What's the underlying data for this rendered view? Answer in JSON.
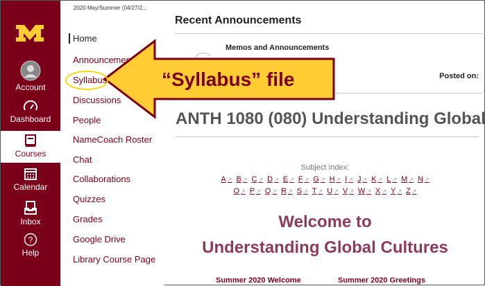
{
  "global_nav": {
    "items": [
      {
        "label": "Account",
        "icon": "account-icon"
      },
      {
        "label": "Dashboard",
        "icon": "dashboard-icon"
      },
      {
        "label": "Courses",
        "icon": "courses-icon",
        "active": true
      },
      {
        "label": "Calendar",
        "icon": "calendar-icon"
      },
      {
        "label": "Inbox",
        "icon": "inbox-icon"
      },
      {
        "label": "Help",
        "icon": "help-icon"
      }
    ],
    "logo": "university-m-logo",
    "colors": {
      "maroon": "#7a0019",
      "gold": "#ffcc33"
    }
  },
  "course_nav": {
    "term": "2020 May/Summer (04/27/2...",
    "items": [
      {
        "label": "Home"
      },
      {
        "label": "Announcements"
      },
      {
        "label": "Syllabus"
      },
      {
        "label": "Discussions"
      },
      {
        "label": "People"
      },
      {
        "label": "NameCoach Roster"
      },
      {
        "label": "Chat"
      },
      {
        "label": "Collaborations"
      },
      {
        "label": "Quizzes"
      },
      {
        "label": "Grades"
      },
      {
        "label": "Google Drive"
      },
      {
        "label": "Library Course Page"
      }
    ]
  },
  "main": {
    "recent_heading": "Recent Announcements",
    "memos": "Memos and Announcements",
    "posted_on": "Posted on:",
    "course_title": "ANTH 1080 (080) Understanding Global ...",
    "subject_index": "Subject Index:",
    "alpha_row1": [
      "A",
      "B",
      "C",
      "D",
      "E",
      "F",
      "G",
      "H",
      "I",
      "J",
      "K",
      "L",
      "M",
      "N"
    ],
    "alpha_row2": [
      "O",
      "P",
      "Q",
      "R",
      "S",
      "T",
      "U",
      "V",
      "W",
      "X",
      "Y",
      "Z"
    ],
    "welcome_line1": "Welcome to",
    "welcome_line2": "Understanding Global Cultures",
    "video_left": "Summer 2020 Welcome",
    "video_right": "Summer 2020 Greetings"
  },
  "callout": {
    "text": "“Syllabus” file",
    "colors": {
      "fill": "#ffcc33",
      "stroke": "#7a0019"
    }
  }
}
